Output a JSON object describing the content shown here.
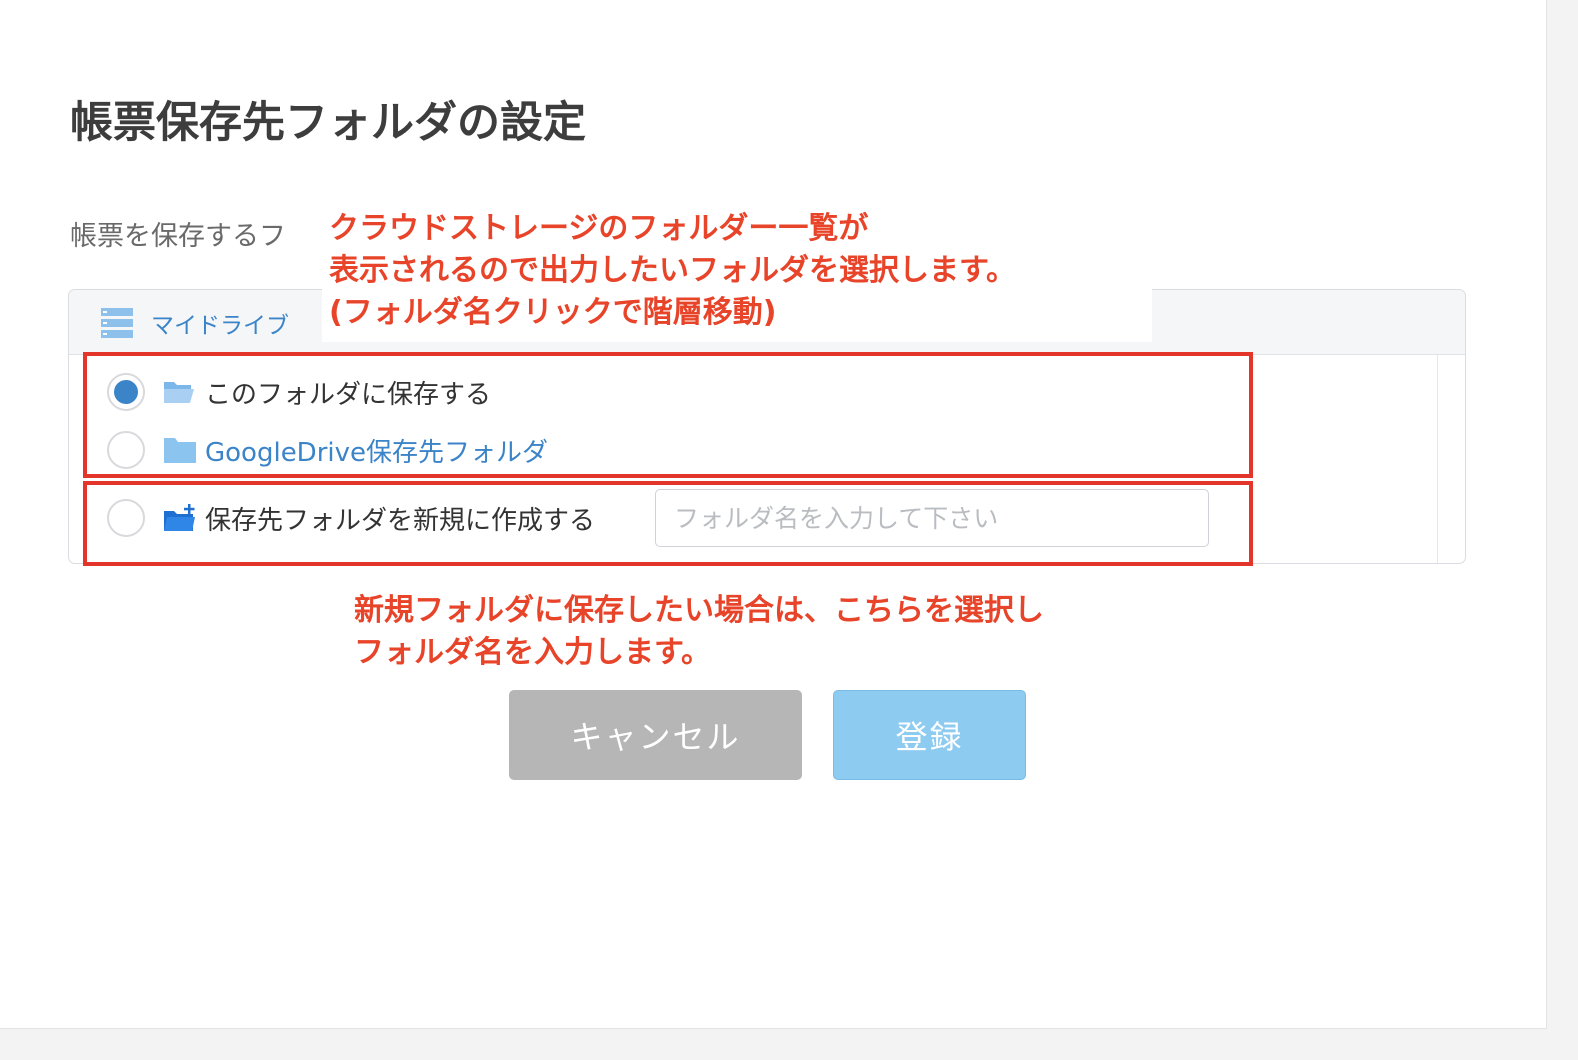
{
  "page": {
    "title": "帳票保存先フォルダの設定",
    "description": "帳票を保存するフ"
  },
  "breadcrumb": {
    "root_label": "マイドライブ",
    "icon": "drive-list-icon"
  },
  "options": {
    "current_folder_label": "このフォルダに保存する",
    "subfolder_label": "GoogleDrive保存先フォルダ",
    "new_folder_label": "保存先フォルダを新規に作成する",
    "selected": "current_folder"
  },
  "new_folder_input": {
    "value": "",
    "placeholder": "フォルダ名を入力して下さい"
  },
  "buttons": {
    "cancel": "キャンセル",
    "register": "登録"
  },
  "annotations": {
    "top_line1": "クラウドストレージのフォルダー一覧が",
    "top_line2": "表示されるので出力したいフォルダを選択します。",
    "top_line3": "(フォルダ名クリックで階層移動)",
    "bottom_line1": "新規フォルダに保存したい場合は、こちらを選択し",
    "bottom_line2": "フォルダ名を入力します。"
  },
  "colors": {
    "accent": "#3b84c8",
    "annotation": "#e8442a",
    "highlight_border": "#e3352a",
    "cancel_button": "#b6b6b6",
    "register_button": "#8ecbf0"
  }
}
